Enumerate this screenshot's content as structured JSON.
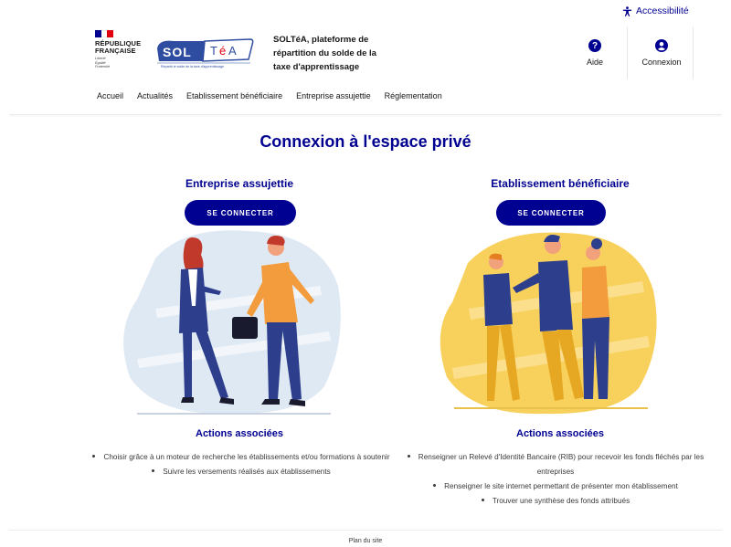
{
  "topbar": {
    "accessibility_label": "Accessibilité"
  },
  "header": {
    "republique": [
      "RÉPUBLIQUE",
      "FRANÇAISE"
    ],
    "devise": [
      "Liberté",
      "Égalité",
      "Fraternité"
    ],
    "logo_text": "SOLTéA",
    "logo_sub": "Répartir le solde de la taxe d'apprentissage",
    "tagline": "SOLTéA, plateforme de répartition du solde de la taxe d'apprentissage",
    "help_label": "Aide",
    "login_label": "Connexion"
  },
  "nav": {
    "items": [
      "Accueil",
      "Actualités",
      "Etablissement bénéficiaire",
      "Entreprise assujettie",
      "Réglementation"
    ]
  },
  "main": {
    "title": "Connexion à l'espace privé",
    "left": {
      "title": "Entreprise assujettie",
      "button": "SE CONNECTER",
      "actions_title": "Actions associées",
      "actions": [
        "Choisir grâce à un moteur de recherche les établissements et/ou formations à soutenir",
        "Suivre les versements réalisés aux établissements"
      ]
    },
    "right": {
      "title": "Etablissement bénéficiaire",
      "button": "SE CONNECTER",
      "actions_title": "Actions associées",
      "actions": [
        "Renseigner un Relevé d'Identité Bancaire (RIB) pour recevoir les fonds fléchés par les entreprises",
        "Renseigner le site internet permettant de présenter mon établissement",
        "Trouver une synthèse des fonds attribués"
      ]
    }
  },
  "footer": {
    "sitemap_label": "Plan du site"
  },
  "colors": {
    "primary": "#000091",
    "left_blob": "#dfe9f4",
    "right_blob": "#f8d15c",
    "flag_blue": "#000091",
    "flag_red": "#e1000f"
  }
}
